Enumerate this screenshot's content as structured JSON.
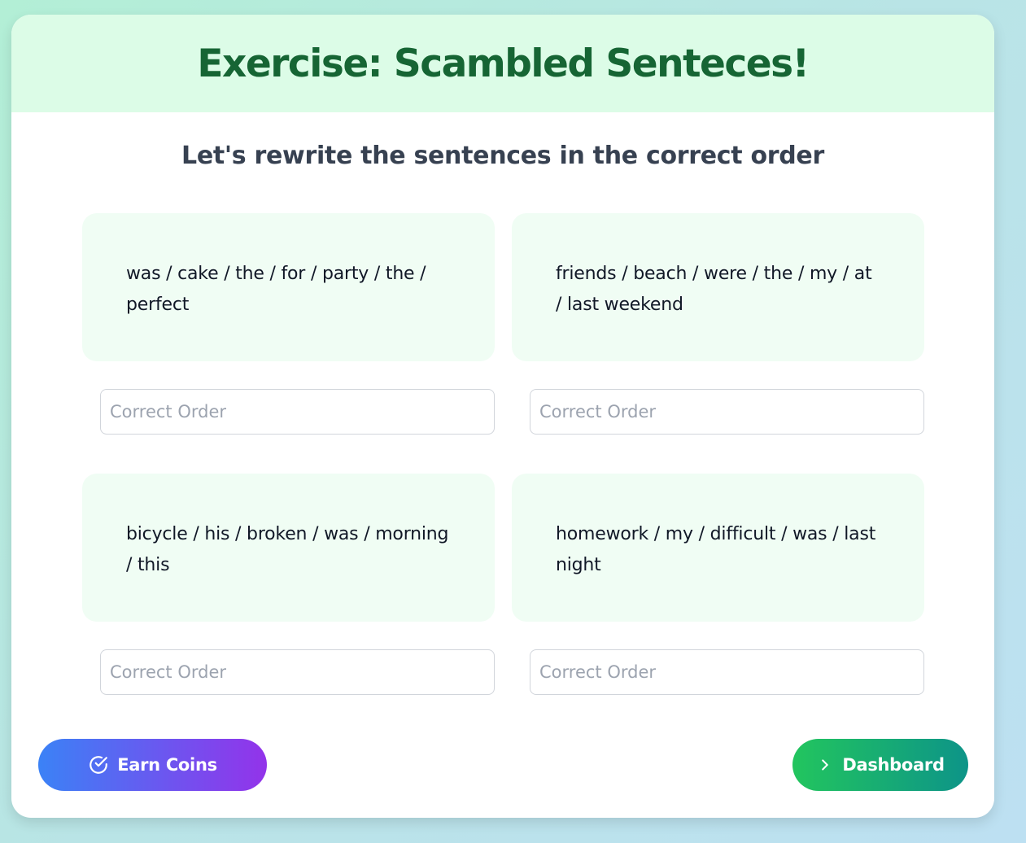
{
  "header": {
    "title": "Exercise: Scambled Senteces!"
  },
  "instruction": "Let's rewrite the sentences in the correct order",
  "exercises": [
    {
      "scrambled": "was / cake / the / for / party / the / perfect",
      "answer_value": "",
      "answer_placeholder": "Correct Order"
    },
    {
      "scrambled": "friends / beach / were / the / my / at / last weekend",
      "answer_value": "",
      "answer_placeholder": "Correct Order"
    },
    {
      "scrambled": "bicycle / his / broken / was / morning / this",
      "answer_value": "",
      "answer_placeholder": "Correct Order"
    },
    {
      "scrambled": "homework / my / difficult / was / last night",
      "answer_value": "",
      "answer_placeholder": "Correct Order"
    }
  ],
  "actions": {
    "earn_coins_label": "Earn Coins",
    "earn_coins_icon": "check-circle-icon",
    "dashboard_label": "Dashboard",
    "dashboard_icon": "chevron-right-icon"
  },
  "colors": {
    "header_bg": "#dcfce7",
    "title": "#166534",
    "scramble_bg": "#f0fdf4",
    "earn_gradient": [
      "#3b82f6",
      "#9333ea"
    ],
    "dashboard_gradient": [
      "#22c55e",
      "#0d9488"
    ]
  }
}
